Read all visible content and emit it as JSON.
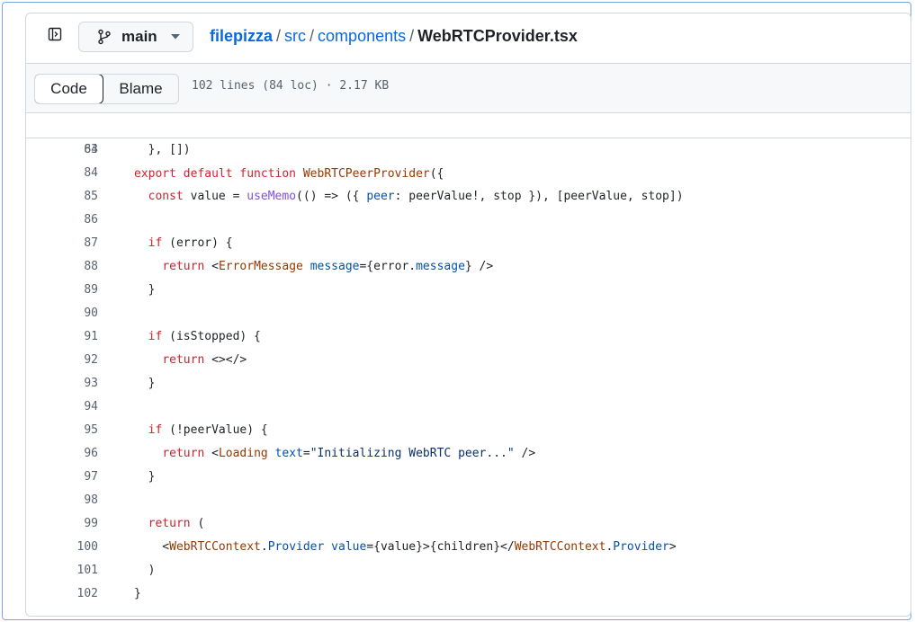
{
  "header": {
    "branch": "main",
    "breadcrumb": {
      "repo": "filepizza",
      "sep1": "/",
      "dir1": "src",
      "sep2": "/",
      "dir2": "components",
      "sep3": "/",
      "file": "WebRTCProvider.tsx"
    }
  },
  "toolbar": {
    "code_label": "Code",
    "blame_label": "Blame",
    "file_meta": "102 lines (84 loc) · 2.17 KB"
  },
  "sticky_line": {
    "number": "64",
    "tokens": [
      {
        "t": "export default function ",
        "c": "kw"
      },
      {
        "t": "WebRTCPeerProvider",
        "c": "tg"
      },
      {
        "t": "({",
        "c": ""
      }
    ]
  },
  "code_lines": [
    {
      "number": "83",
      "tokens": [
        {
          "t": "  }, [])",
          "c": ""
        }
      ]
    },
    {
      "number": "84",
      "tokens": []
    },
    {
      "number": "85",
      "tokens": [
        {
          "t": "  ",
          "c": ""
        },
        {
          "t": "const",
          "c": "kw"
        },
        {
          "t": " value = ",
          "c": ""
        },
        {
          "t": "useMemo",
          "c": "fn"
        },
        {
          "t": "(() => ({ ",
          "c": ""
        },
        {
          "t": "peer",
          "c": "at"
        },
        {
          "t": ": peerValue!, stop }), [peerValue, stop])",
          "c": ""
        }
      ]
    },
    {
      "number": "86",
      "tokens": []
    },
    {
      "number": "87",
      "tokens": [
        {
          "t": "  ",
          "c": ""
        },
        {
          "t": "if",
          "c": "kw"
        },
        {
          "t": " (error) {",
          "c": ""
        }
      ]
    },
    {
      "number": "88",
      "tokens": [
        {
          "t": "    ",
          "c": ""
        },
        {
          "t": "return",
          "c": "kw"
        },
        {
          "t": " <",
          "c": ""
        },
        {
          "t": "ErrorMessage",
          "c": "tg"
        },
        {
          "t": " ",
          "c": ""
        },
        {
          "t": "message",
          "c": "at"
        },
        {
          "t": "={error.",
          "c": ""
        },
        {
          "t": "message",
          "c": "at"
        },
        {
          "t": "} />",
          "c": ""
        }
      ]
    },
    {
      "number": "89",
      "tokens": [
        {
          "t": "  }",
          "c": ""
        }
      ]
    },
    {
      "number": "90",
      "tokens": []
    },
    {
      "number": "91",
      "tokens": [
        {
          "t": "  ",
          "c": ""
        },
        {
          "t": "if",
          "c": "kw"
        },
        {
          "t": " (isStopped) {",
          "c": ""
        }
      ]
    },
    {
      "number": "92",
      "tokens": [
        {
          "t": "    ",
          "c": ""
        },
        {
          "t": "return",
          "c": "kw"
        },
        {
          "t": " <></>",
          "c": ""
        }
      ]
    },
    {
      "number": "93",
      "tokens": [
        {
          "t": "  }",
          "c": ""
        }
      ]
    },
    {
      "number": "94",
      "tokens": []
    },
    {
      "number": "95",
      "tokens": [
        {
          "t": "  ",
          "c": ""
        },
        {
          "t": "if",
          "c": "kw"
        },
        {
          "t": " (!peerValue) {",
          "c": ""
        }
      ]
    },
    {
      "number": "96",
      "tokens": [
        {
          "t": "    ",
          "c": ""
        },
        {
          "t": "return",
          "c": "kw"
        },
        {
          "t": " <",
          "c": ""
        },
        {
          "t": "Loading",
          "c": "tg"
        },
        {
          "t": " ",
          "c": ""
        },
        {
          "t": "text",
          "c": "at"
        },
        {
          "t": "=",
          "c": ""
        },
        {
          "t": "\"Initializing WebRTC peer...\"",
          "c": "st"
        },
        {
          "t": " />",
          "c": ""
        }
      ]
    },
    {
      "number": "97",
      "tokens": [
        {
          "t": "  }",
          "c": ""
        }
      ]
    },
    {
      "number": "98",
      "tokens": []
    },
    {
      "number": "99",
      "tokens": [
        {
          "t": "  ",
          "c": ""
        },
        {
          "t": "return",
          "c": "kw"
        },
        {
          "t": " (",
          "c": ""
        }
      ]
    },
    {
      "number": "100",
      "tokens": [
        {
          "t": "    <",
          "c": ""
        },
        {
          "t": "WebRTCContext",
          "c": "tg"
        },
        {
          "t": ".",
          "c": ""
        },
        {
          "t": "Provider",
          "c": "at"
        },
        {
          "t": " ",
          "c": ""
        },
        {
          "t": "value",
          "c": "at"
        },
        {
          "t": "={value}>{children}</",
          "c": ""
        },
        {
          "t": "WebRTCContext",
          "c": "tg"
        },
        {
          "t": ".",
          "c": ""
        },
        {
          "t": "Provider",
          "c": "at"
        },
        {
          "t": ">",
          "c": ""
        }
      ]
    },
    {
      "number": "101",
      "tokens": [
        {
          "t": "  )",
          "c": ""
        }
      ]
    },
    {
      "number": "102",
      "tokens": [
        {
          "t": "}",
          "c": ""
        }
      ]
    }
  ]
}
